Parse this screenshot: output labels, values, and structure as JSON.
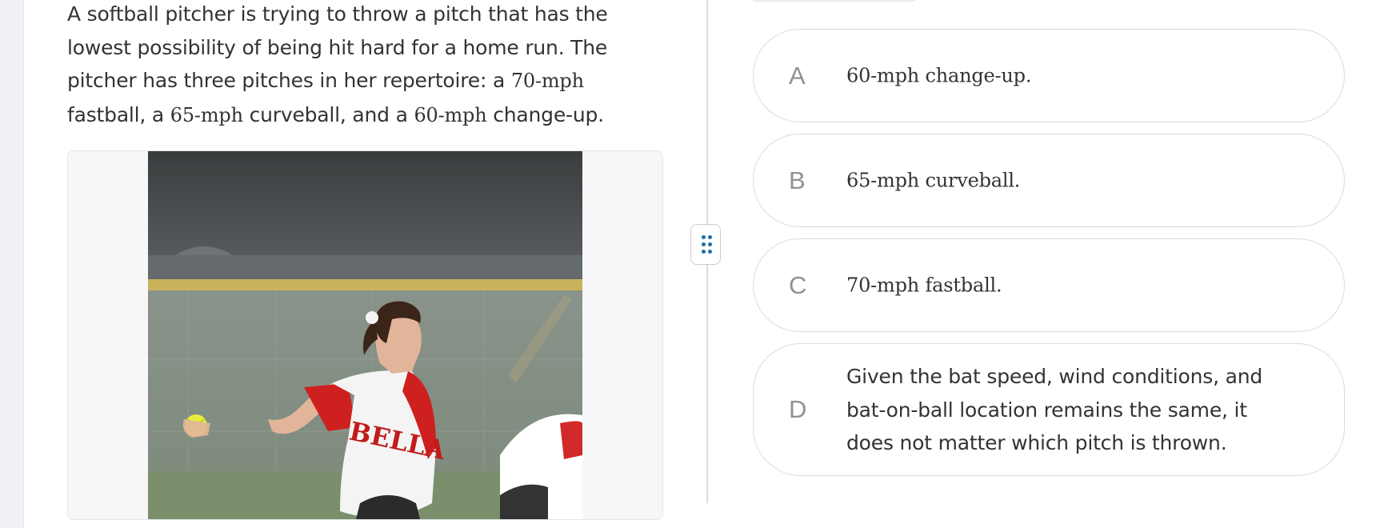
{
  "question": {
    "text_before": "A softball pitcher is trying to throw a pitch that has the lowest possibility of being hit hard for a home run. The pitcher has three pitches in her repertoire: a ",
    "speed_1": "70-mph",
    "text_mid_1": " fastball, a ",
    "speed_2": "65-mph",
    "text_mid_2": " curveball, and a ",
    "speed_3": "60-mph",
    "text_after": " change-up."
  },
  "image": {
    "jersey_text": "BELLA"
  },
  "choices": [
    {
      "letter": "A",
      "label": "60-mph change-up."
    },
    {
      "letter": "B",
      "label": "65-mph curveball."
    },
    {
      "letter": "C",
      "label": "70-mph fastball."
    },
    {
      "letter": "D",
      "label": "Given the bat speed, wind conditions, and bat-on-ball location remains the same, it does not matter which pitch is thrown."
    }
  ],
  "icons": {
    "drag_handle": "drag-grip-icon"
  },
  "colors": {
    "accent": "#1f6fa8",
    "border": "#d9dbe0",
    "letter": "#8e9196"
  }
}
